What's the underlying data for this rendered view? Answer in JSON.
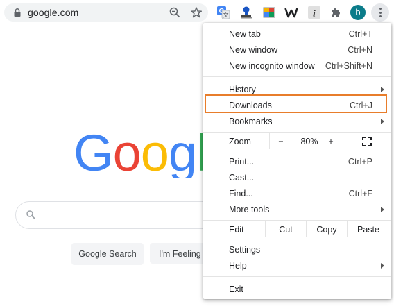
{
  "toolbar": {
    "url": "google.com",
    "avatar_letter": "b",
    "extensions": [
      "google-translate-icon",
      "stamp-extension-icon",
      "tag-extension-icon",
      "w-extension-icon",
      "info-extension-icon",
      "puzzle-icon"
    ]
  },
  "page": {
    "logo": "Google",
    "buttons": {
      "search": "Google Search",
      "lucky": "I'm Feeling Lucky"
    }
  },
  "menu": {
    "new_tab": {
      "label": "New tab",
      "shortcut": "Ctrl+T"
    },
    "new_window": {
      "label": "New window",
      "shortcut": "Ctrl+N"
    },
    "new_incognito": {
      "label": "New incognito window",
      "shortcut": "Ctrl+Shift+N"
    },
    "history": {
      "label": "History"
    },
    "downloads": {
      "label": "Downloads",
      "shortcut": "Ctrl+J"
    },
    "bookmarks": {
      "label": "Bookmarks"
    },
    "zoom": {
      "label": "Zoom",
      "minus": "−",
      "level": "80%",
      "plus": "+"
    },
    "print": {
      "label": "Print...",
      "shortcut": "Ctrl+P"
    },
    "cast": {
      "label": "Cast..."
    },
    "find": {
      "label": "Find...",
      "shortcut": "Ctrl+F"
    },
    "more_tools": {
      "label": "More tools"
    },
    "edit": {
      "label": "Edit",
      "cut": "Cut",
      "copy": "Copy",
      "paste": "Paste"
    },
    "settings": {
      "label": "Settings"
    },
    "help": {
      "label": "Help"
    },
    "exit": {
      "label": "Exit"
    }
  },
  "colors": {
    "highlight": "#e87d2b",
    "avatar": "#0b7c8a"
  }
}
